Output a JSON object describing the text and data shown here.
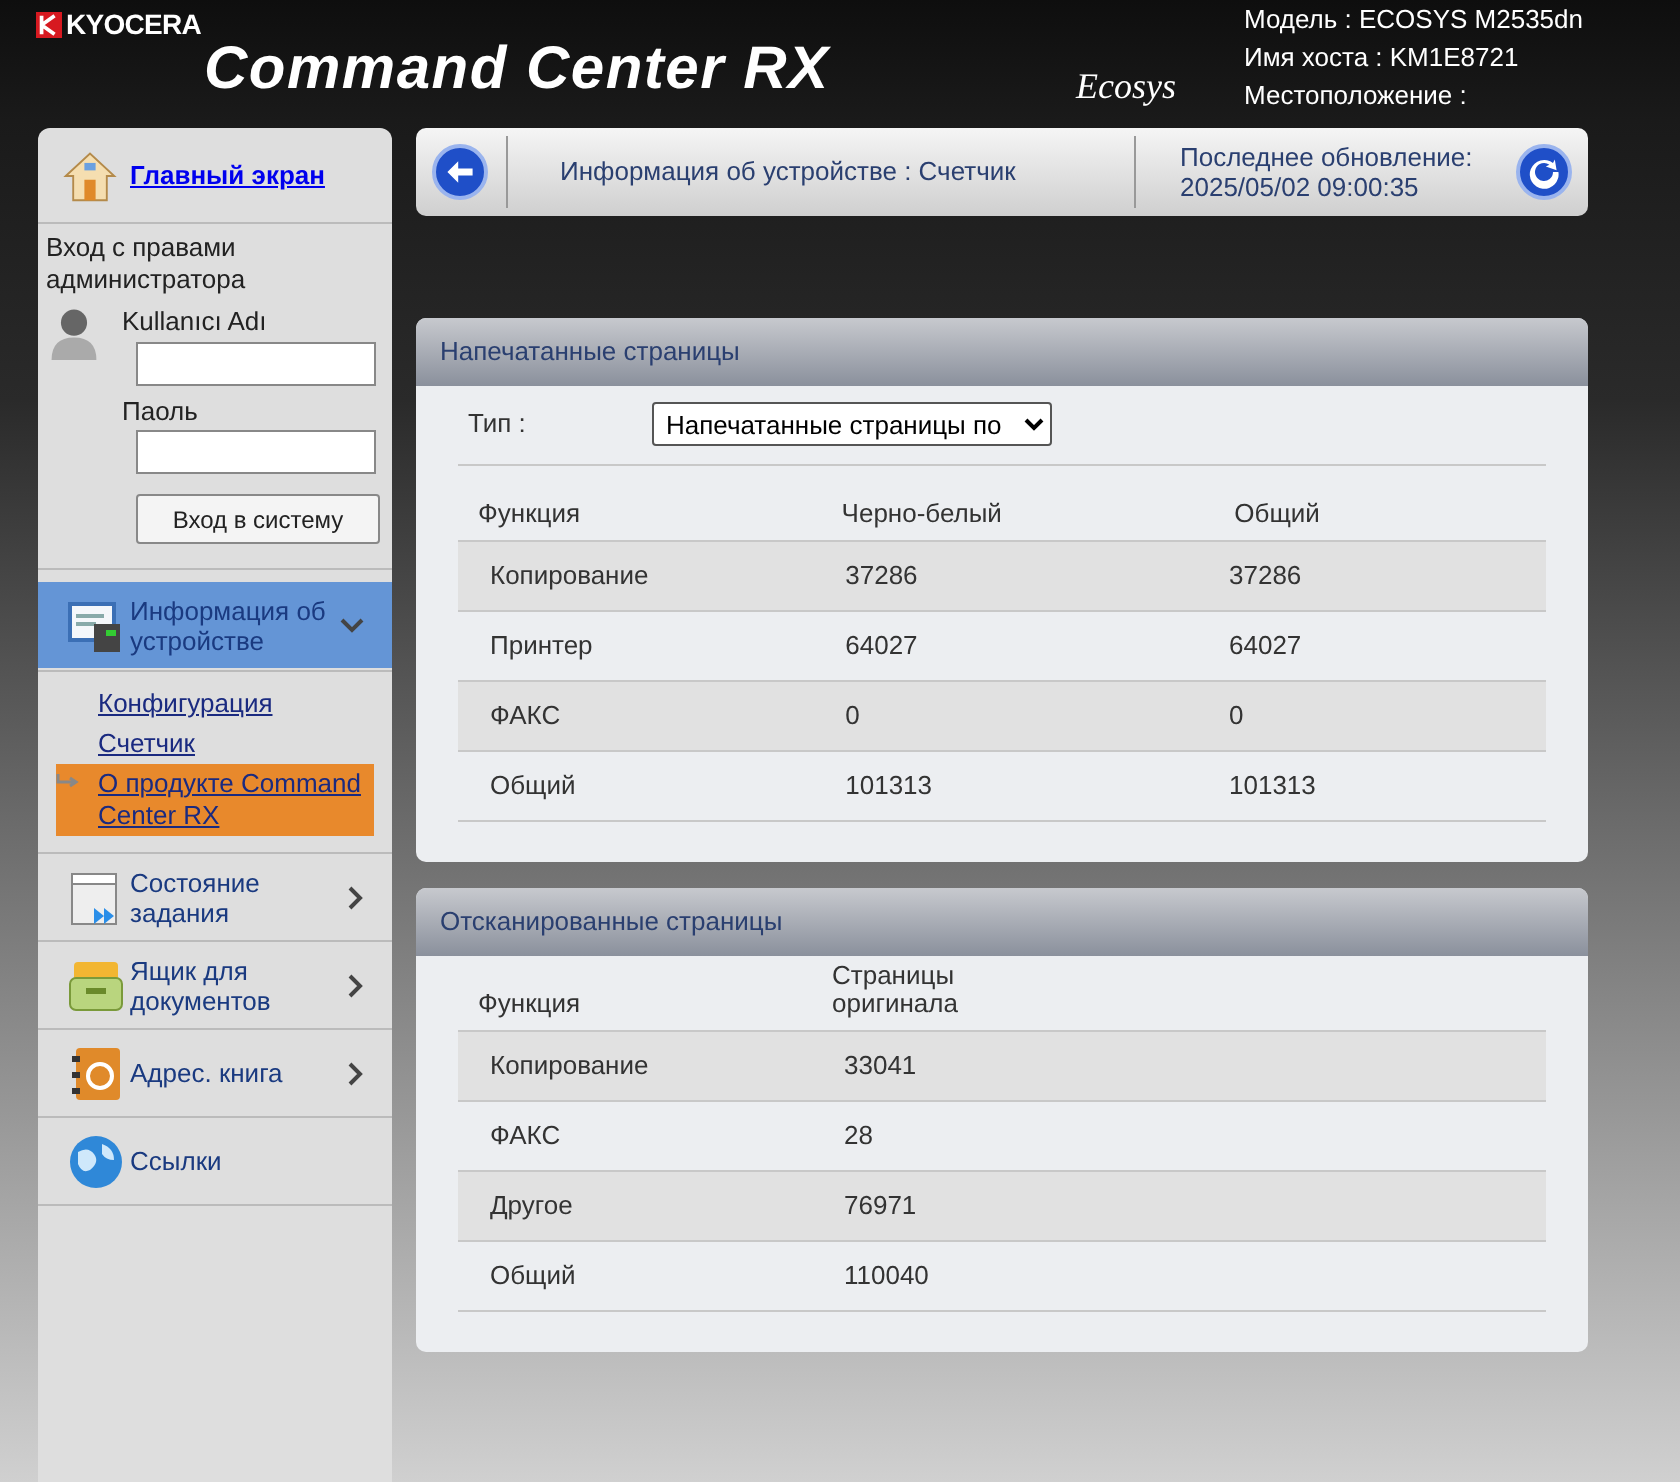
{
  "header": {
    "brand": "KYOCERA",
    "title": "Command Center RX",
    "logo": "Ecosys",
    "info": [
      "Модель : ECOSYS M2535dn",
      "Имя хоста : KM1E8721",
      "Местоположение :"
    ]
  },
  "sidebar": {
    "home_link": "Главный экран",
    "login": {
      "title": "Вход с правами администратора",
      "username_label": "Kullanıcı Adı",
      "password_label": "Паоль",
      "button": "Вход в систему"
    },
    "menu": [
      {
        "kind": "device",
        "label": "Информация об устройстве",
        "expanded": true,
        "children": [
          {
            "label": "Конфигурация",
            "selected": false
          },
          {
            "label": "Счетчик",
            "selected": false
          },
          {
            "label": "О продукте Command Center RX",
            "selected": true
          }
        ]
      },
      {
        "kind": "jobs",
        "label": "Состояние задания",
        "expanded": false
      },
      {
        "kind": "box",
        "label": "Ящик для документов",
        "expanded": false
      },
      {
        "kind": "address",
        "label": "Адрес. книга",
        "expanded": false
      },
      {
        "kind": "links",
        "label": "Ссылки"
      }
    ]
  },
  "toolbar": {
    "breadcrumb": "Информация об устройстве : Счетчик",
    "updated_label": "Последнее обновление:",
    "updated_time": "2025/05/02 09:00:35"
  },
  "printed": {
    "title": "Напечатанные страницы",
    "type_label": "Тип :",
    "type_value": "Напечатанные страницы по",
    "columns": [
      "Функция",
      "Черно-белый",
      "Общий"
    ],
    "rows": [
      [
        "Копирование",
        "37286",
        "37286"
      ],
      [
        "Принтер",
        "64027",
        "64027"
      ],
      [
        "ФАКС",
        "0",
        "0"
      ],
      [
        "Общий",
        "101313",
        "101313"
      ]
    ]
  },
  "scanned": {
    "title": "Отсканированные страницы",
    "columns": [
      "Функция",
      "Страницы оригинала"
    ],
    "rows": [
      [
        "Копирование",
        "33041"
      ],
      [
        "ФАКС",
        "28"
      ],
      [
        "Другое",
        "76971"
      ],
      [
        "Общий",
        "110040"
      ]
    ]
  }
}
